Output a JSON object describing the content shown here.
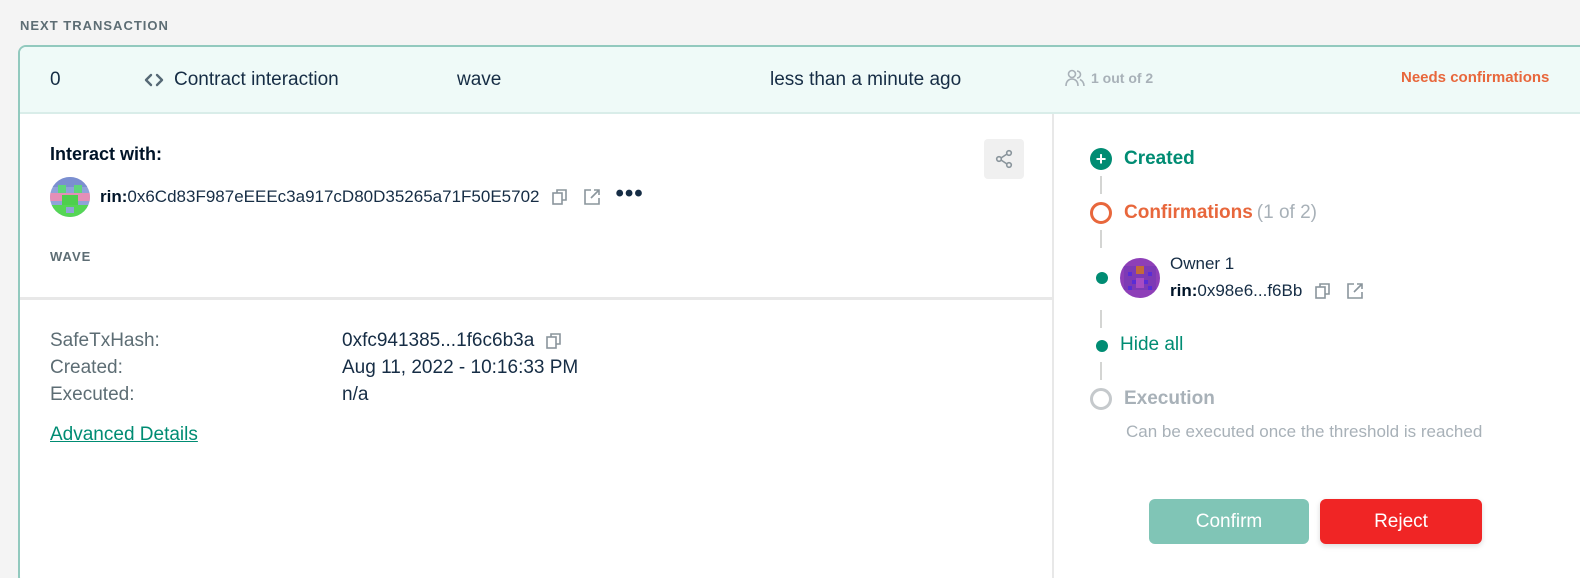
{
  "section_label": "NEXT TRANSACTION",
  "summary": {
    "nonce": "0",
    "type_label": "Contract interaction",
    "type_icon": "code-icon",
    "method": "wave",
    "time": "less than a minute ago",
    "confirmations": "1 out of 2",
    "status": "Needs confirmations",
    "status_color": "#e8673c"
  },
  "details": {
    "interact_title": "Interact with:",
    "address_prefix": "rin:",
    "address": "0x6Cd83F987eEEEc3a917cD80D35265a71F50E5702",
    "more_label": "•••",
    "method_label": "WAVE",
    "rows": [
      {
        "key": "SafeTxHash:",
        "value": "0xfc941385...1f6c6b3a"
      },
      {
        "key": "Created:",
        "value": "Aug 11, 2022 - 10:16:33 PM"
      },
      {
        "key": "Executed:",
        "value": "n/a"
      }
    ],
    "advanced_link": "Advanced Details"
  },
  "timeline": {
    "created": "Created",
    "created_symbol": "+",
    "confirmations_label": "Confirmations",
    "confirmations_count": "(1 of 2)",
    "owner_name": "Owner 1",
    "owner_prefix": "rin:",
    "owner_address": "0x98e6...f6Bb",
    "hide_all": "Hide all",
    "execution": "Execution",
    "execution_note": "Can be executed once the threshold is reached"
  },
  "actions": {
    "confirm": "Confirm",
    "reject": "Reject"
  },
  "colors": {
    "accent": "#008c73",
    "warning": "#e8673c",
    "danger": "#f02525"
  }
}
